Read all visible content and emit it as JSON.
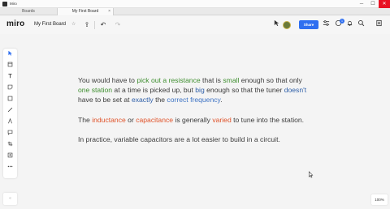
{
  "window": {
    "app_name": "Miro",
    "minimize": "─",
    "maximize": "☐",
    "close": "✕"
  },
  "tabs": [
    {
      "label": "Boards"
    },
    {
      "label": "My First Board",
      "close": "×"
    }
  ],
  "topbar": {
    "logo": "miro",
    "board_name": "My First Board",
    "star_icon": "☆",
    "upload_icon": "⇪",
    "undo_icon": "↶",
    "redo_icon": "↷",
    "share_label": "Share",
    "notifications_badge": "1",
    "icons": [
      "cursor-icon",
      "avatar",
      "share-button",
      "settings-icon",
      "comments-icon",
      "bell-icon",
      "search-icon",
      "panel-icon"
    ]
  },
  "left_tools": [
    "select-icon",
    "frame-icon",
    "text-icon",
    "sticky-note-icon",
    "shape-icon",
    "line-icon",
    "pen-icon",
    "comment-icon",
    "crop-icon",
    "upload-icon",
    "more-icon"
  ],
  "canvas": {
    "p1": {
      "a": "You would have to ",
      "b": "pick out a resistance",
      "c": " that is ",
      "d": "small",
      "e": " enough so that only ",
      "f": "one station",
      "g": " at a time is picked up, but ",
      "h": "big",
      "i": " enough so that the tuner ",
      "j": "doesn't",
      "k": " have to be set at ",
      "l": "exactly",
      "m": " the ",
      "n": "correct frequency",
      "o": "."
    },
    "p2": {
      "a": "The ",
      "b": "inductance",
      "c": " or ",
      "d": "capacitance",
      "e": " is generally ",
      "f": "varied",
      "g": " to tune into the station."
    },
    "p3": "In practice, variable capacitors are a lot easier to build in a circuit."
  },
  "bottom": {
    "zoom": "100%",
    "collapse_icon": "«"
  }
}
